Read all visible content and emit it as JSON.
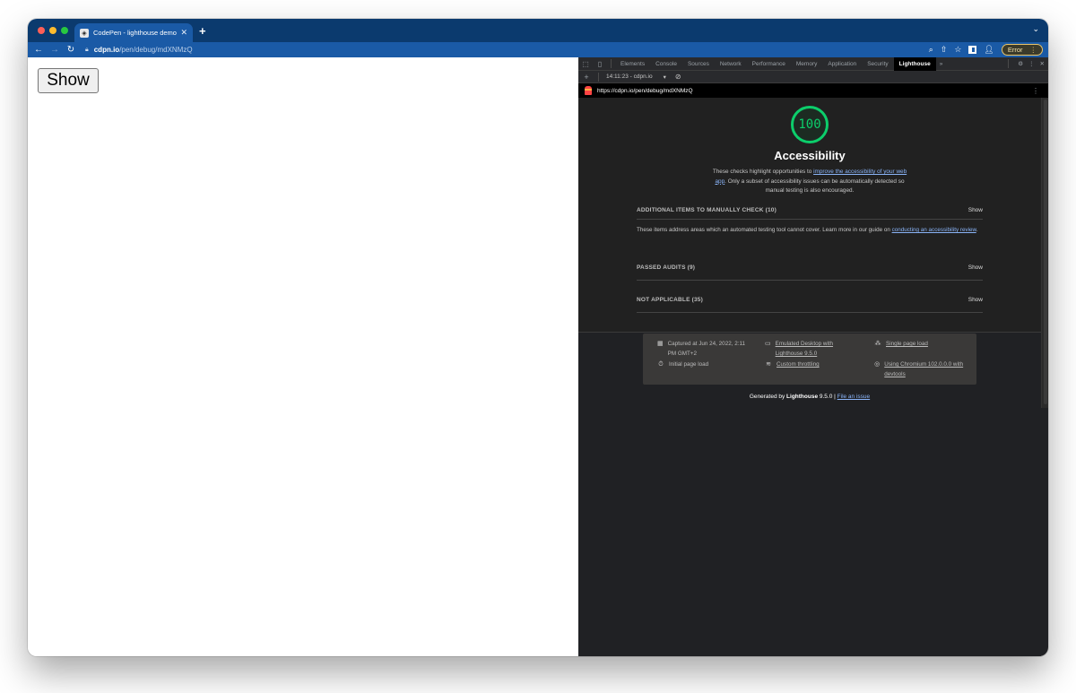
{
  "browser": {
    "tab": {
      "title": "CodePen - lighthouse demo",
      "favicon": "codepen-icon"
    },
    "address": {
      "host": "cdpn.io",
      "path": "/pen/debug/mdXNMzQ"
    },
    "error_label": "Error",
    "nav": {
      "back": "←",
      "forward": "→",
      "reload": "C"
    }
  },
  "page": {
    "show_button": "Show"
  },
  "devtools": {
    "tabs": [
      "Elements",
      "Console",
      "Sources",
      "Network",
      "Performance",
      "Memory",
      "Application",
      "Security",
      "Lighthouse"
    ],
    "active_tab": "Lighthouse",
    "report_select": "14:11:23 - cdpn.io",
    "report_url": "https://cdpn.io/pen/debug/mdXNMzQ"
  },
  "report": {
    "score": "100",
    "score_color": "#0cce6b",
    "category": "Accessibility",
    "desc_prefix": "These checks highlight opportunities to ",
    "desc_link": "improve the accessibility of your web app",
    "desc_suffix": ". Only a subset of accessibility issues can be automatically detected so manual testing is also encouraged.",
    "groups": [
      {
        "title": "ADDITIONAL ITEMS TO MANUALLY CHECK (10)",
        "toggle": "Show",
        "desc_prefix": "These items address areas which an automated testing tool cannot cover. Learn more in our guide on ",
        "desc_link": "conducting an accessibility review",
        "desc_suffix": "."
      },
      {
        "title": "PASSED AUDITS (9)",
        "toggle": "Show"
      },
      {
        "title": "NOT APPLICABLE (35)",
        "toggle": "Show"
      }
    ],
    "meta": {
      "captured": "Captured at Jun 24, 2022, 2:11 PM GMT+2",
      "load": "Initial page load",
      "emulated": "Emulated Desktop with Lighthouse 9.5.0",
      "throttling": "Custom throttling",
      "session": "Single page load",
      "browser": "Using Chromium 102.0.0.0 with devtools"
    },
    "footer": {
      "generated_by": "Generated by ",
      "tool": "Lighthouse",
      "version": " 9.5.0 | ",
      "issue_link": "File an issue"
    }
  }
}
